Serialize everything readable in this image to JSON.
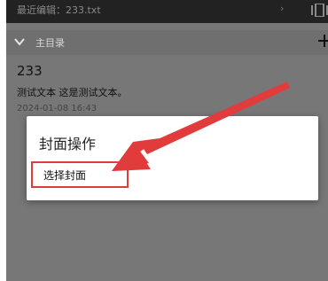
{
  "recent": {
    "text": "最近编辑：233.txt",
    "chevron": "›"
  },
  "directory": {
    "label": "主目录"
  },
  "note": {
    "title": "233",
    "body": "测试文本 这是测试文本。",
    "date": "2024-01-08 16:43"
  },
  "dialog": {
    "title": "封面操作",
    "option": "选择封面"
  },
  "colors": {
    "highlight": "#e23b3b"
  }
}
